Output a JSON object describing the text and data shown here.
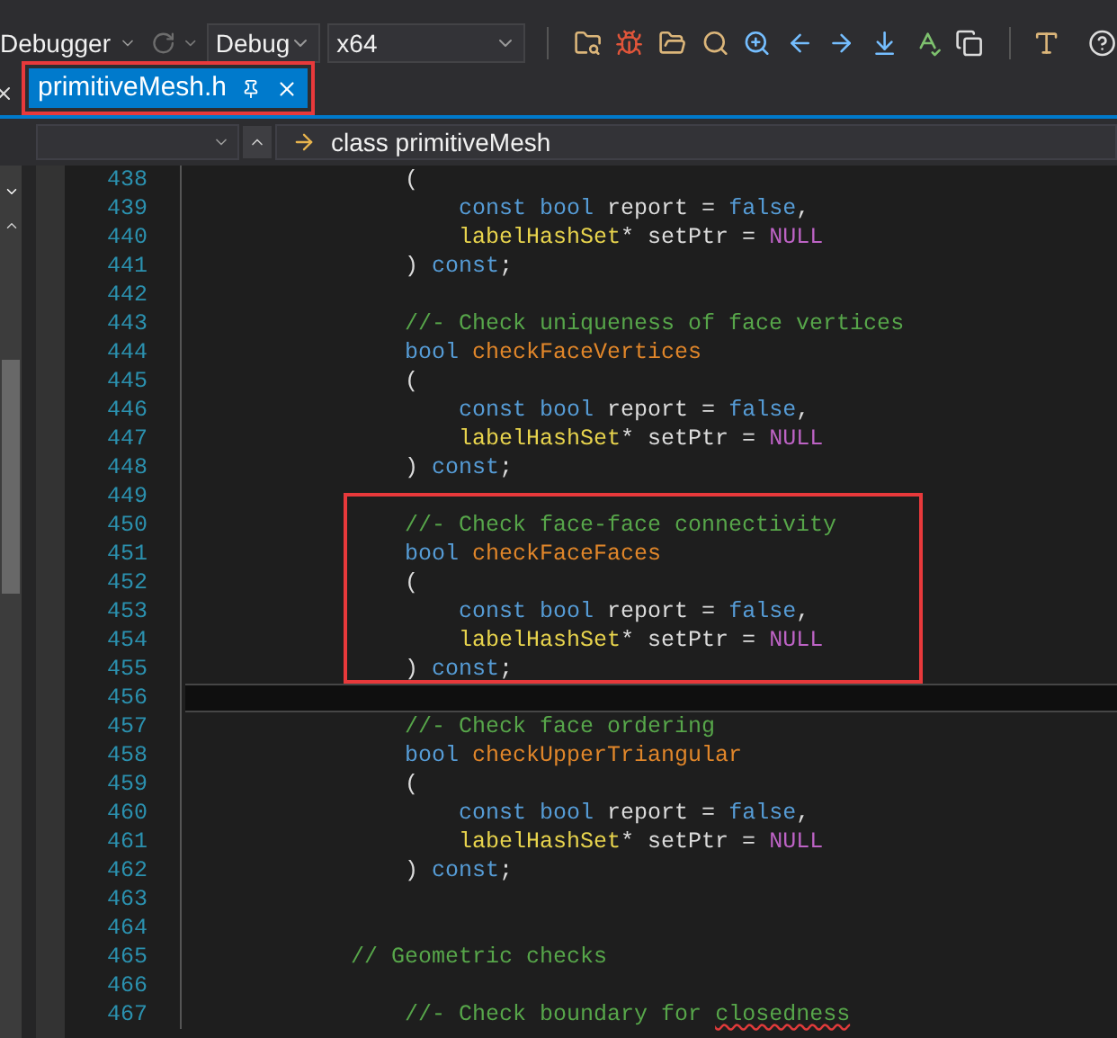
{
  "toolbar": {
    "debugger_menu": "Debugger",
    "configuration": "Debug",
    "platform": "x64"
  },
  "tabs": [
    {
      "label": "primitiveMesh.h",
      "selected": true,
      "outlined": true
    }
  ],
  "navigation_bar": {
    "scope": "class primitiveMesh"
  },
  "editor": {
    "lines": [
      {
        "number": "438",
        "tokens": [
          {
            "kind": "plain",
            "text": "                ("
          }
        ]
      },
      {
        "number": "439",
        "tokens": [
          {
            "kind": "kw",
            "text": "                    const bool"
          },
          {
            "kind": "plain",
            "text": " report = "
          },
          {
            "kind": "kw",
            "text": "false"
          },
          {
            "kind": "plain",
            "text": ","
          }
        ]
      },
      {
        "number": "440",
        "tokens": [
          {
            "kind": "type",
            "text": "                    labelHashSet"
          },
          {
            "kind": "plain",
            "text": "* setPtr = "
          },
          {
            "kind": "null",
            "text": "NULL"
          }
        ]
      },
      {
        "number": "441",
        "tokens": [
          {
            "kind": "plain",
            "text": "                ) "
          },
          {
            "kind": "kw",
            "text": "const"
          },
          {
            "kind": "plain",
            "text": ";"
          }
        ]
      },
      {
        "number": "442"
      },
      {
        "number": "443",
        "tokens": [
          {
            "kind": "cm",
            "text": "                //- Check uniqueness of face vertices"
          }
        ]
      },
      {
        "number": "444",
        "tokens": [
          {
            "kind": "kw",
            "text": "                bool"
          },
          {
            "kind": "fn",
            "text": " checkFaceVertices"
          }
        ]
      },
      {
        "number": "445",
        "tokens": [
          {
            "kind": "plain",
            "text": "                ("
          }
        ]
      },
      {
        "number": "446",
        "tokens": [
          {
            "kind": "kw",
            "text": "                    const bool"
          },
          {
            "kind": "plain",
            "text": " report = "
          },
          {
            "kind": "kw",
            "text": "false"
          },
          {
            "kind": "plain",
            "text": ","
          }
        ]
      },
      {
        "number": "447",
        "tokens": [
          {
            "kind": "type",
            "text": "                    labelHashSet"
          },
          {
            "kind": "plain",
            "text": "* setPtr = "
          },
          {
            "kind": "null",
            "text": "NULL"
          }
        ]
      },
      {
        "number": "448",
        "tokens": [
          {
            "kind": "plain",
            "text": "                ) "
          },
          {
            "kind": "kw",
            "text": "const"
          },
          {
            "kind": "plain",
            "text": ";"
          }
        ]
      },
      {
        "number": "449"
      },
      {
        "number": "450",
        "outlined": true,
        "tokens": [
          {
            "kind": "cm",
            "text": "                //- Check face-face connectivity"
          }
        ]
      },
      {
        "number": "451",
        "outlined": true,
        "tokens": [
          {
            "kind": "kw",
            "text": "                bool"
          },
          {
            "kind": "fn",
            "text": " checkFaceFaces"
          }
        ]
      },
      {
        "number": "452",
        "outlined": true,
        "tokens": [
          {
            "kind": "plain",
            "text": "                ("
          }
        ]
      },
      {
        "number": "453",
        "outlined": true,
        "tokens": [
          {
            "kind": "kw",
            "text": "                    const bool"
          },
          {
            "kind": "plain",
            "text": " report = "
          },
          {
            "kind": "kw",
            "text": "false"
          },
          {
            "kind": "plain",
            "text": ","
          }
        ]
      },
      {
        "number": "454",
        "outlined": true,
        "tokens": [
          {
            "kind": "type",
            "text": "                    labelHashSet"
          },
          {
            "kind": "plain",
            "text": "* setPtr = "
          },
          {
            "kind": "null",
            "text": "NULL"
          }
        ]
      },
      {
        "number": "455",
        "outlined": true,
        "tokens": [
          {
            "kind": "plain",
            "text": "                ) "
          },
          {
            "kind": "kw",
            "text": "const"
          },
          {
            "kind": "plain",
            "text": ";"
          }
        ]
      },
      {
        "number": "456",
        "current": true
      },
      {
        "number": "457",
        "tokens": [
          {
            "kind": "cm",
            "text": "                //- Check face ordering"
          }
        ]
      },
      {
        "number": "458",
        "tokens": [
          {
            "kind": "kw",
            "text": "                bool"
          },
          {
            "kind": "fn",
            "text": " checkUpperTriangular"
          }
        ]
      },
      {
        "number": "459",
        "tokens": [
          {
            "kind": "plain",
            "text": "                ("
          }
        ]
      },
      {
        "number": "460",
        "tokens": [
          {
            "kind": "kw",
            "text": "                    const bool"
          },
          {
            "kind": "plain",
            "text": " report = "
          },
          {
            "kind": "kw",
            "text": "false"
          },
          {
            "kind": "plain",
            "text": ","
          }
        ]
      },
      {
        "number": "461",
        "tokens": [
          {
            "kind": "type",
            "text": "                    labelHashSet"
          },
          {
            "kind": "plain",
            "text": "* setPtr = "
          },
          {
            "kind": "null",
            "text": "NULL"
          }
        ]
      },
      {
        "number": "462",
        "tokens": [
          {
            "kind": "plain",
            "text": "                ) "
          },
          {
            "kind": "kw",
            "text": "const"
          },
          {
            "kind": "plain",
            "text": ";"
          }
        ]
      },
      {
        "number": "463"
      },
      {
        "number": "464"
      },
      {
        "number": "465",
        "tokens": [
          {
            "kind": "cm",
            "text": "            // Geometric checks"
          }
        ]
      },
      {
        "number": "466"
      },
      {
        "number": "467",
        "tokens": [
          {
            "kind": "cm",
            "text": "                //- Check boundary for "
          },
          {
            "kind": "cm",
            "text": "closedness",
            "misspelled": true
          }
        ]
      }
    ]
  }
}
